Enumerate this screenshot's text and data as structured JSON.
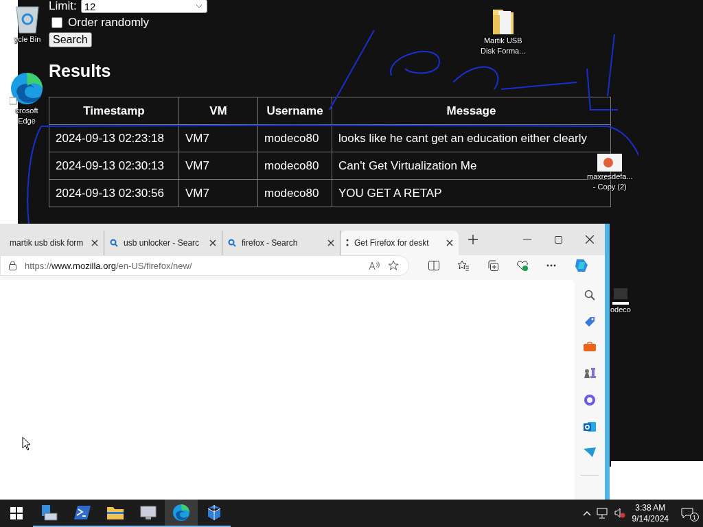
{
  "web_page": {
    "limit_label": "Limit:",
    "limit_value": "12",
    "order_randomly": {
      "label": "Order randomly",
      "checked": false
    },
    "search_button": "Search",
    "results_heading": "Results",
    "table": {
      "columns": [
        "Timestamp",
        "VM",
        "Username",
        "Message"
      ],
      "rows": [
        [
          "2024-09-13 02:23:18",
          "VM7",
          "modeco80",
          "looks like he cant get an education either clearly"
        ],
        [
          "2024-09-13 02:30:13",
          "VM7",
          "modeco80",
          "Can't Get Virtualization Me"
        ],
        [
          "2024-09-13 02:30:56",
          "VM7",
          "modeco80",
          "YOU GET A RETAP"
        ]
      ]
    }
  },
  "desktop_icons": [
    {
      "kind": "recycle",
      "lines": [
        "ycle Bin"
      ]
    },
    {
      "kind": "edge",
      "lines": [
        "crosoft",
        "Edge"
      ]
    },
    {
      "kind": "folder",
      "lines": [
        "Martik USB",
        "Disk Forma..."
      ]
    },
    {
      "kind": "image",
      "lines": [
        "maxresdefa...",
        "- Copy (2)"
      ]
    },
    {
      "kind": "shortcut",
      "lines": [
        "odeco"
      ]
    }
  ],
  "browser": {
    "tabs": [
      {
        "title": "martik usb disk form",
        "kind": "plain",
        "selected": false
      },
      {
        "title": "usb unlocker - Searc",
        "kind": "search",
        "selected": false
      },
      {
        "title": "firefox - Search",
        "kind": "search",
        "selected": false
      },
      {
        "title": "Get Firefox for deskt",
        "kind": "loading",
        "selected": true
      }
    ],
    "url": {
      "scheme": "https://",
      "host": "www.mozilla.org",
      "path": "/en-US/firefox/new/"
    }
  },
  "taskbar": {
    "apps": [
      {
        "kind": "server",
        "active": false
      },
      {
        "kind": "powershell",
        "active": false
      },
      {
        "kind": "explorer",
        "active": false
      },
      {
        "kind": "monitor",
        "active": false
      },
      {
        "kind": "edge",
        "active": true
      },
      {
        "kind": "cubes",
        "active": false
      }
    ],
    "time": "3:38 AM",
    "date": "9/14/2024",
    "notification_count": "1"
  }
}
